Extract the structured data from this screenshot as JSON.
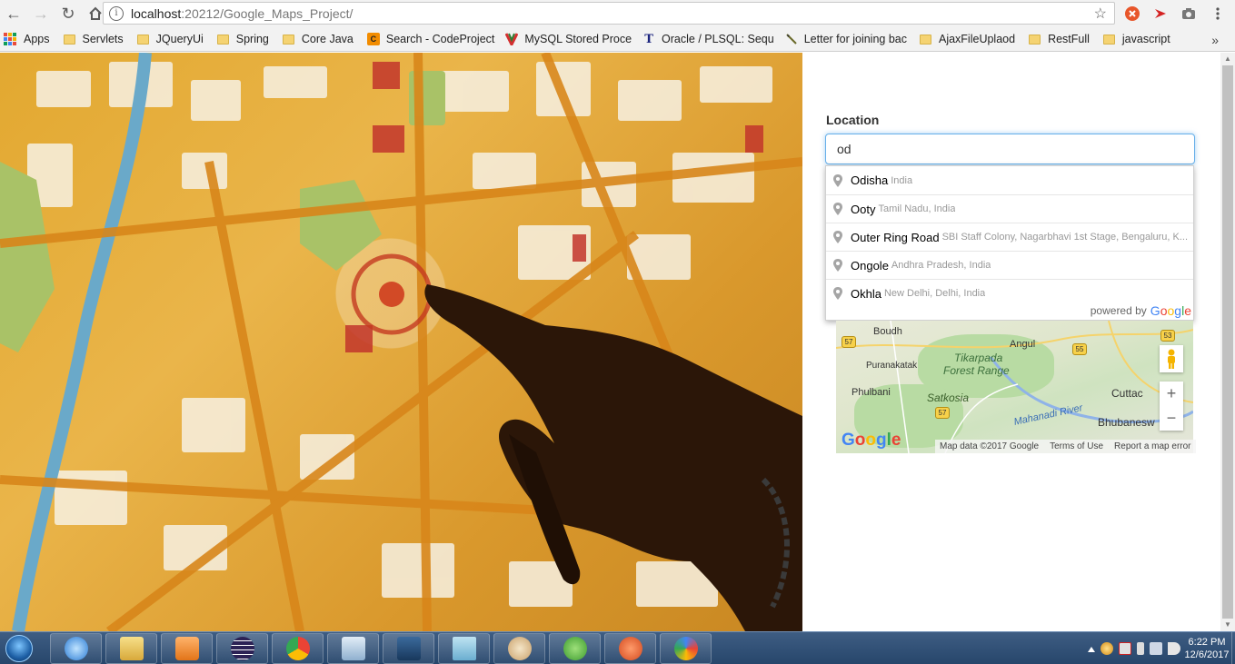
{
  "browser": {
    "url_host": "localhost",
    "url_rest": ":20212/Google_Maps_Project/",
    "bookmarks": [
      {
        "label": "Apps",
        "type": "apps"
      },
      {
        "label": "Servlets",
        "type": "folder"
      },
      {
        "label": "JQueryUi",
        "type": "folder"
      },
      {
        "label": "Spring",
        "type": "folder"
      },
      {
        "label": "Core Java",
        "type": "folder"
      },
      {
        "label": "Search - CodeProject",
        "type": "site"
      },
      {
        "label": "MySQL Stored Proce",
        "type": "site"
      },
      {
        "label": "Oracle / PLSQL: Sequ",
        "type": "site"
      },
      {
        "label": "Letter for joining bac",
        "type": "site"
      },
      {
        "label": "AjaxFileUplaod",
        "type": "folder"
      },
      {
        "label": "RestFull",
        "type": "folder"
      },
      {
        "label": "javascript",
        "type": "folder"
      }
    ],
    "more": "»"
  },
  "form": {
    "location_label": "Location",
    "location_value": "od"
  },
  "autocomplete": {
    "items": [
      {
        "main": "Odisha",
        "secondary": "India"
      },
      {
        "main": "Ooty",
        "secondary": "Tamil Nadu, India"
      },
      {
        "main": "Outer Ring Road",
        "secondary": "SBI Staff Colony, Nagarbhavi 1st Stage, Bengaluru, K..."
      },
      {
        "main": "Ongole",
        "secondary": "Andhra Pradesh, India"
      },
      {
        "main": "Okhla",
        "secondary": "New Delhi, Delhi, India"
      }
    ],
    "powered_by": "powered by",
    "google": "Google"
  },
  "map": {
    "labels": {
      "boudh": "Boudh",
      "angul": "Angul",
      "tikarpada": "Tikarpada",
      "forest_range": "Forest Range",
      "puranakatak": "Puranakatak",
      "phulbani": "Phulbani",
      "satkosia": "Satkosia",
      "cuttack": "Cuttac",
      "mahanadi": "Mahanadi River",
      "bhubaneswar": "Bhubanesw"
    },
    "shields": {
      "s57a": "57",
      "s55": "55",
      "s53": "53",
      "s57b": "57"
    },
    "zoom_in": "+",
    "zoom_out": "−",
    "google": "Google",
    "map_data": "Map data ©2017 Google",
    "terms": "Terms of Use",
    "report": "Report a map error"
  },
  "taskbar": {
    "time": "6:22 PM",
    "date": "12/6/2017"
  }
}
